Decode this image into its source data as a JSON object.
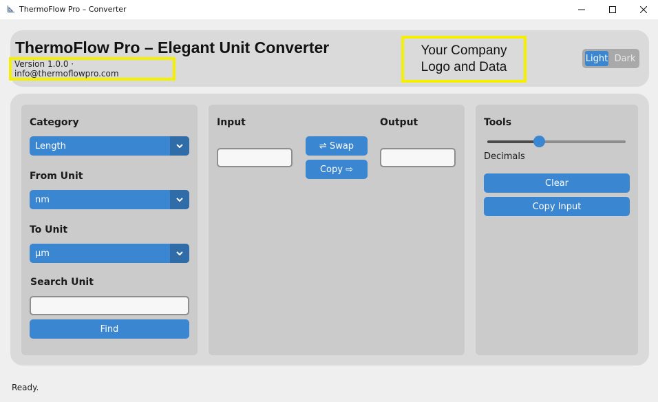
{
  "window": {
    "title": "ThermoFlow Pro – Converter",
    "controls": [
      "minimize-icon",
      "maximize-icon",
      "close-icon"
    ]
  },
  "header": {
    "title": "ThermoFlow Pro – Elegant Unit Converter",
    "version_line": "Version 1.0.0 · info@thermoflowpro.com",
    "logo_placeholder": "Your Company\nLogo and Data",
    "theme": {
      "light_label": "Light",
      "dark_label": "Dark",
      "selected": "Light"
    }
  },
  "left_panel": {
    "category_label": "Category",
    "category_value": "Length",
    "from_label": "From Unit",
    "from_value": "nm",
    "to_label": "To Unit",
    "to_value": "µm",
    "search_label": "Search Unit",
    "search_value": "",
    "find_label": "Find"
  },
  "middle_panel": {
    "input_label": "Input",
    "input_value": "",
    "output_label": "Output",
    "output_value": "",
    "swap_label": "⇌ Swap",
    "copy_label": "Copy ⇨"
  },
  "right_panel": {
    "tools_label": "Tools",
    "decimals_label": "Decimals",
    "decimals_fraction": 0.38,
    "clear_label": "Clear",
    "copy_input_label": "Copy Input"
  },
  "status": {
    "text": "Ready."
  },
  "colors": {
    "accent": "#3a86d0",
    "highlight_border": "#f5f000",
    "panel_bg": "#cbcbcb",
    "frame_bg": "#dadada"
  }
}
